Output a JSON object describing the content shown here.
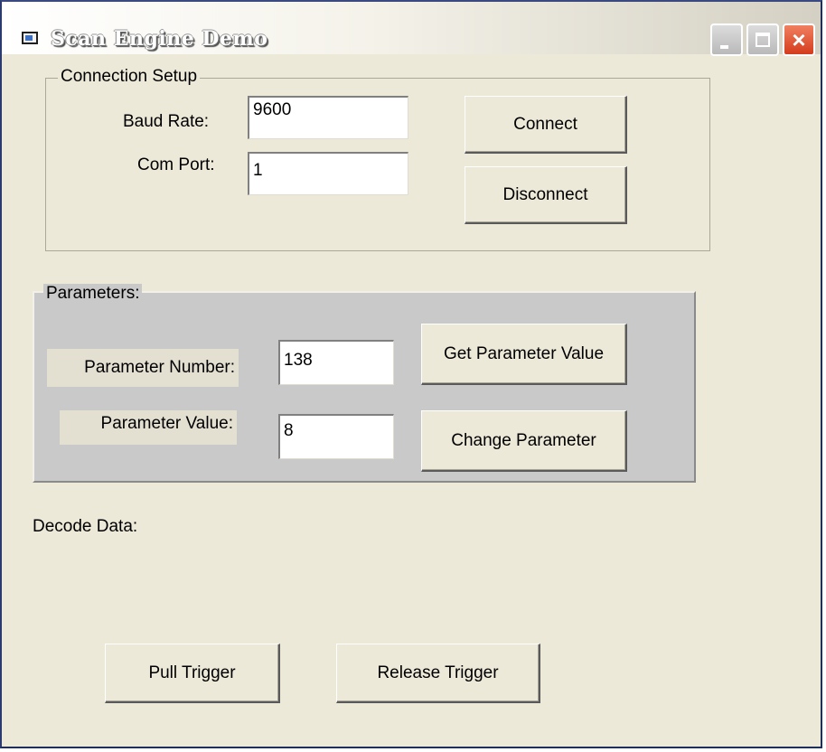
{
  "window": {
    "title": "Scan Engine Demo",
    "icon": "app-window-icon",
    "controls": {
      "minimize": "minimize-icon",
      "maximize": "maximize-icon",
      "close": "×"
    }
  },
  "connection": {
    "group_label": "Connection Setup",
    "baud_label": "Baud Rate:",
    "baud_value": "9600",
    "com_label": "Com Port:",
    "com_value": "1",
    "connect_label": "Connect",
    "disconnect_label": "Disconnect"
  },
  "parameters": {
    "group_label": "Parameters:",
    "number_label": "Parameter Number:",
    "number_value": "138",
    "value_label": "Parameter Value:",
    "value_value": "8",
    "get_label": "Get Parameter Value",
    "change_label": "Change Parameter"
  },
  "decode": {
    "label": "Decode Data:"
  },
  "trigger": {
    "pull_label": "Pull Trigger",
    "release_label": "Release Trigger"
  },
  "colors": {
    "face": "#ece9d8",
    "param_panel": "#c9c9c9",
    "close_button": "#d43c1c"
  }
}
